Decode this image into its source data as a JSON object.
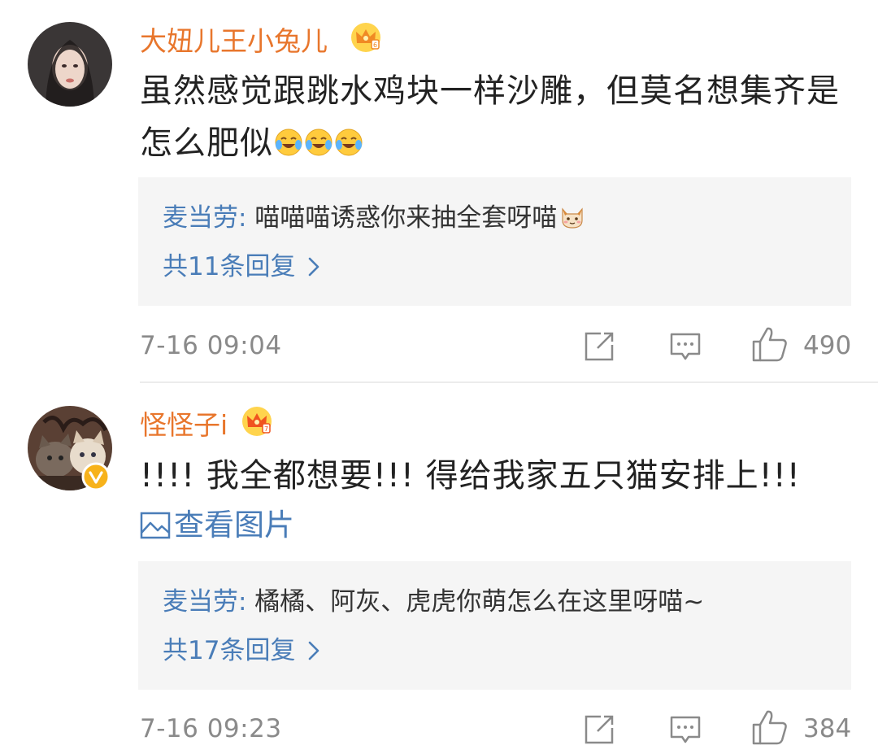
{
  "comments": [
    {
      "username": "大妞儿王小兔儿",
      "text": "虽然感觉跟跳水鸡块一样沙雕，但莫名想集齐是怎么肥似",
      "emojis": [
        "laugh-cry-icon",
        "laugh-cry-icon",
        "laugh-cry-icon"
      ],
      "reply": {
        "author": "麦当劳:",
        "text": " 喵喵喵诱惑你来抽全套呀喵",
        "count_label": "共11条回复"
      },
      "timestamp": "7-16 09:04",
      "likes": "490"
    },
    {
      "username": "怪怪子i",
      "text": "!!!! 我全都想要!!! 得给我家五只猫安排上!!!",
      "view_pictures": "查看图片",
      "reply": {
        "author": "麦当劳:",
        "text": " 橘橘、阿灰、虎虎你萌怎么在这里呀喵~",
        "count_label": "共17条回复"
      },
      "timestamp": "7-16 09:23",
      "likes": "384"
    }
  ],
  "colors": {
    "username": "#e8762c",
    "link": "#4a7db8",
    "meta": "#8a8a8a",
    "reply_bg": "#f5f5f5"
  }
}
